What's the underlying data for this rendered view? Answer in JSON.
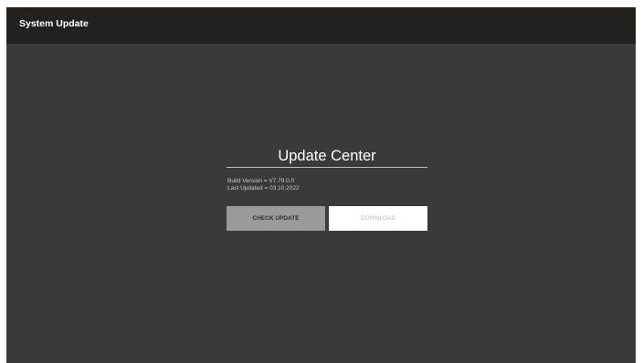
{
  "window": {
    "title": "System Update"
  },
  "main": {
    "heading": "Update Center",
    "build_version": "Build Version = V7.79.0.0",
    "last_updated": "Last Updated = 03.10.2022"
  },
  "buttons": {
    "check_update": "CHECK UPDATE",
    "download": "DOWNLOAD"
  },
  "colors": {
    "background": "#3a3a3a",
    "titlebar": "#232020",
    "check_button": "#9a9a9a",
    "download_button": "#ffffff"
  }
}
